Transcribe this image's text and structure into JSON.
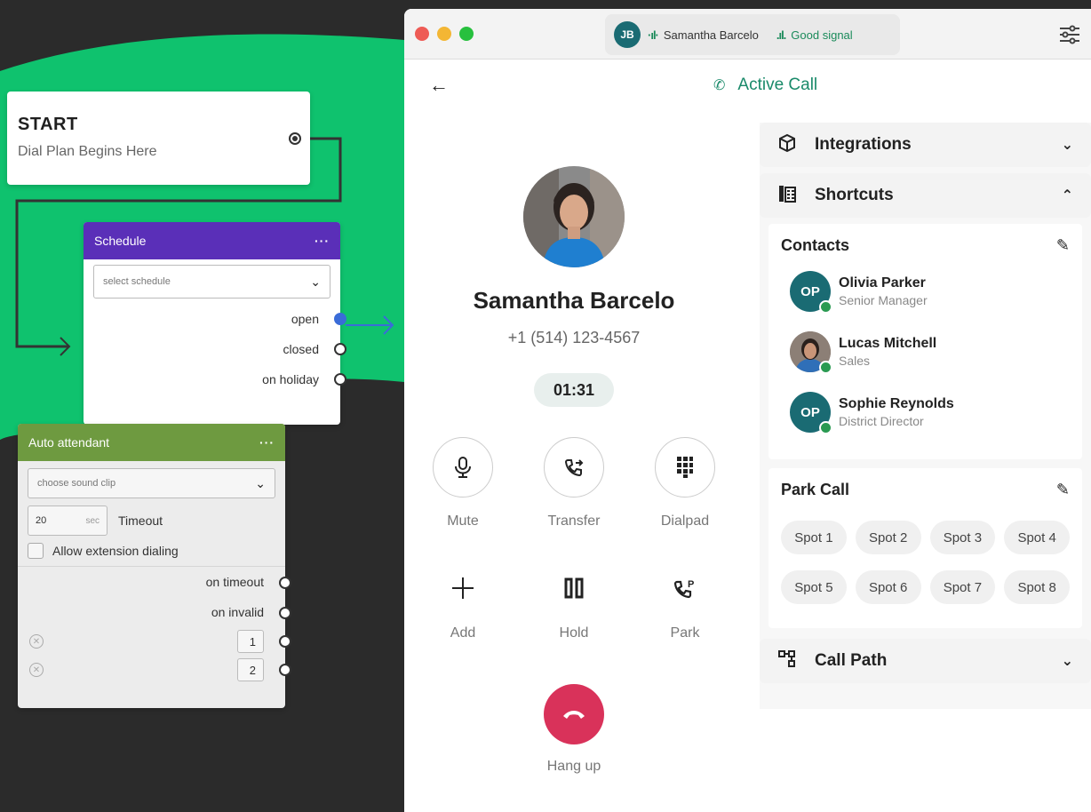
{
  "flow": {
    "start": {
      "title": "START",
      "subtitle": "Dial Plan Begins Here"
    },
    "schedule": {
      "title": "Schedule",
      "menu": "···",
      "select_placeholder": "select schedule",
      "outputs": [
        "open",
        "closed",
        "on holiday"
      ]
    },
    "auto_attendant": {
      "title": "Auto attendant",
      "menu": "···",
      "sound_placeholder": "choose sound clip",
      "timeout_value": "20",
      "timeout_unit": "sec",
      "timeout_label": "Timeout",
      "allow_ext_label": "Allow extension dialing",
      "outputs": [
        "on timeout",
        "on invalid"
      ],
      "digits": [
        "1",
        "2"
      ]
    }
  },
  "app": {
    "window_dots": [
      "close",
      "minimize",
      "maximize"
    ],
    "caller_initials": "JB",
    "caller_pill_name": "Samantha Barcelo",
    "signal_text": "Good signal",
    "header_title": "Active Call",
    "caller": {
      "name": "Samantha Barcelo",
      "phone": "+1 (514) 123-4567",
      "timer": "01:31"
    },
    "controls": {
      "mute": "Mute",
      "transfer": "Transfer",
      "dialpad": "Dialpad",
      "add": "Add",
      "hold": "Hold",
      "park": "Park",
      "hangup": "Hang up"
    },
    "panel": {
      "integrations": "Integrations",
      "shortcuts": "Shortcuts",
      "contacts_title": "Contacts",
      "contacts": [
        {
          "initials": "OP",
          "name": "Olivia Parker",
          "role": "Senior Manager"
        },
        {
          "initials": "",
          "name": "Lucas Mitchell",
          "role": "Sales"
        },
        {
          "initials": "OP",
          "name": "Sophie Reynolds",
          "role": "District Director"
        }
      ],
      "park_title": "Park Call",
      "spots": [
        "Spot 1",
        "Spot 2",
        "Spot 3",
        "Spot 4",
        "Spot 5",
        "Spot 6",
        "Spot 7",
        "Spot 8"
      ],
      "call_path": "Call Path"
    }
  },
  "colors": {
    "green_bg": "#0fc26e",
    "schedule_header": "#5a2fb8",
    "aa_header": "#6e9a40",
    "accent": "#1a8a6a",
    "hangup": "#d9325a"
  },
  "icons": [
    "back-arrow-icon",
    "phone-icon",
    "mute-icon",
    "transfer-icon",
    "dialpad-icon",
    "add-icon",
    "hold-icon",
    "park-icon",
    "hangup-icon",
    "cube-icon",
    "building-icon",
    "pencil-icon",
    "call-path-icon",
    "chevron-down-icon",
    "chevron-up-icon",
    "settings-sliders-icon",
    "audio-wave-icon",
    "signal-bars-icon"
  ]
}
